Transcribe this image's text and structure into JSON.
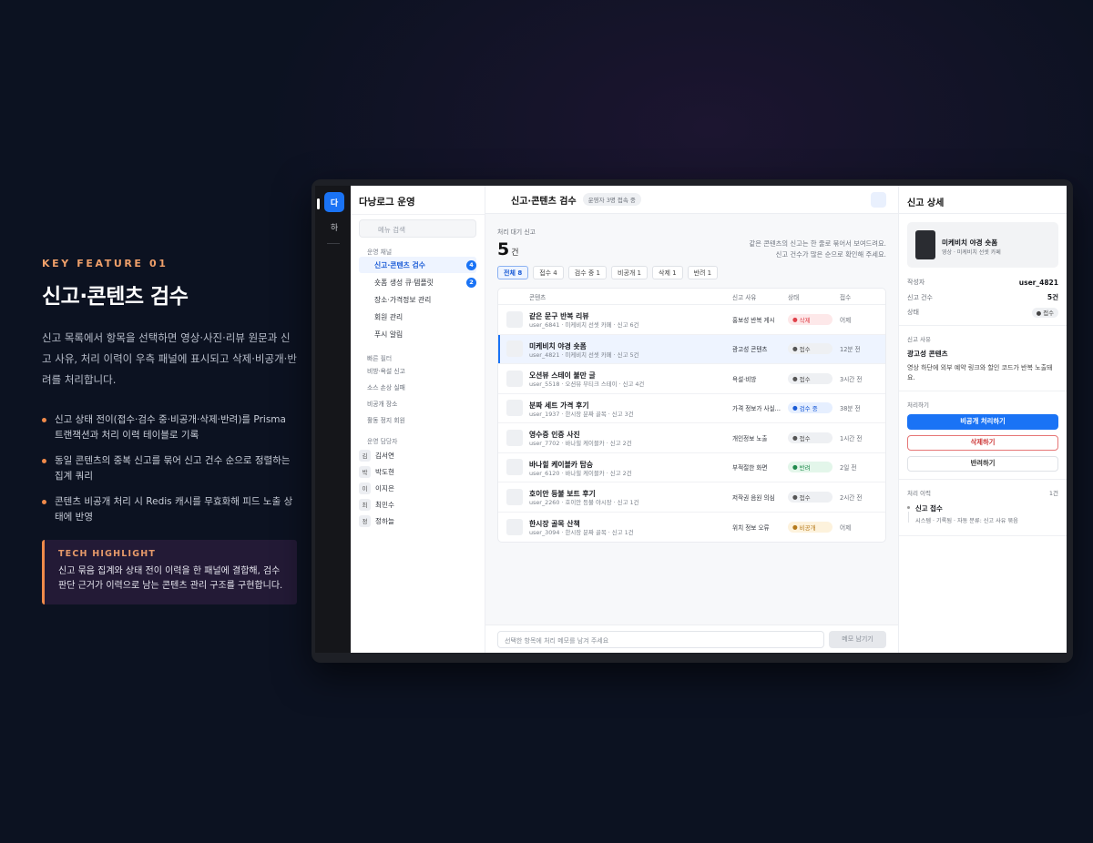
{
  "presentation": {
    "kicker": "KEY FEATURE 01",
    "title": "신고·콘텐츠 검수",
    "description": "신고 목록에서 항목을 선택하면 영상·사진·리뷰 원문과 신고 사유, 처리 이력이 우측 패널에 표시되고 삭제·비공개·반려를 처리합니다.",
    "bullets": [
      "신고 상태 전이(접수·검수 중·비공개·삭제·반려)를 Prisma 트랜잭션과 처리 이력 테이블로 기록",
      "동일 콘텐츠의 중복 신고를 묶어 신고 건수 순으로 정렬하는 집계 쿼리",
      "콘텐츠 비공개 처리 시 Redis 캐시를 무효화해 피드 노출 상태에 반영"
    ],
    "tech_title": "TECH HIGHLIGHT",
    "tech_desc": "신고 묶음 집계와 상태 전이 이력을 한 패널에 결합해, 검수 판단 근거가 이력으로 남는 콘텐츠 관리 구조를 구현합니다."
  },
  "rail": {
    "primary": "다",
    "secondary": "하"
  },
  "sidebar": {
    "brand": "다낭로그 운영",
    "search_placeholder": "메뉴 검색",
    "section_ops": "운영 채널",
    "items": [
      {
        "label": "신고·콘텐츠 검수",
        "badge": "4"
      },
      {
        "label": "숏폼 생성 큐·템플릿",
        "badge": "2"
      },
      {
        "label": "장소·가격정보 관리",
        "badge": ""
      },
      {
        "label": "회원 관리",
        "badge": ""
      },
      {
        "label": "푸시 알림",
        "badge": ""
      }
    ],
    "section_filter": "빠른 필터",
    "filters": [
      "비방·욕설 신고",
      "소스 손상 실패",
      "비공개 장소",
      "활동 정지 회원"
    ],
    "section_owner": "운영 담당자",
    "owners": [
      {
        "initial": "김",
        "name": "김서연"
      },
      {
        "initial": "박",
        "name": "박도현"
      },
      {
        "initial": "이",
        "name": "이지은"
      },
      {
        "initial": "최",
        "name": "최민수"
      },
      {
        "initial": "정",
        "name": "정하늘"
      }
    ]
  },
  "main": {
    "title": "신고·콘텐츠 검수",
    "chip": "운영자 3명 접속 중",
    "queue_label": "처리 대기 신고",
    "queue_count": "5",
    "queue_unit": "건",
    "note_line1": "같은 콘텐츠의 신고는 한 줄로 묶어서 보여드려요.",
    "note_line2": "신고 건수가 많은 순으로 확인해 주세요.",
    "tabs": [
      "전체 8",
      "접수 4",
      "검수 중 1",
      "비공개 1",
      "삭제 1",
      "반려 1"
    ],
    "columns": {
      "content": "콘텐츠",
      "reason": "신고 사유",
      "status": "상태",
      "time": "접수"
    },
    "rows": [
      {
        "title": "같은 문구 반복 리뷰",
        "sub": "user_6841 · 미케비치 선셋 카페 · 신고 6건",
        "reason": "홍보성 반복 게시",
        "status": "삭제",
        "status_color": "#e0414a",
        "status_bg": "#fde8e9",
        "time": "어제"
      },
      {
        "title": "미케비치 야경 숏폼",
        "sub": "user_4821 · 미케비치 선셋 카페 · 신고 5건",
        "reason": "광고성 콘텐츠",
        "status": "접수",
        "status_color": "#555555",
        "status_bg": "#eef0f3",
        "time": "12분 전"
      },
      {
        "title": "오션뷰 스테이 불만 글",
        "sub": "user_5518 · 오션뷰 부티크 스테이 · 신고 4건",
        "reason": "욕설·비방",
        "status": "접수",
        "status_color": "#555555",
        "status_bg": "#eef0f3",
        "time": "3시간 전"
      },
      {
        "title": "분짜 세트 가격 후기",
        "sub": "user_1937 · 한시장 분짜 골목 · 신고 3건",
        "reason": "가격 정보가 사실...",
        "status": "검수 중",
        "status_color": "#1a5bd6",
        "status_bg": "#e6efff",
        "time": "38분 전"
      },
      {
        "title": "영수증 인증 사진",
        "sub": "user_7702 · 바나힐 케이블카 · 신고 2건",
        "reason": "개인정보 노출",
        "status": "접수",
        "status_color": "#555555",
        "status_bg": "#eef0f3",
        "time": "1시간 전"
      },
      {
        "title": "바나힐 케이블카 탑승",
        "sub": "user_6120 · 바나힐 케이블카 · 신고 2건",
        "reason": "부적절한 화면",
        "status": "반려",
        "status_color": "#1f8a4c",
        "status_bg": "#e3f6ea",
        "time": "2일 전"
      },
      {
        "title": "호이안 등불 보트 후기",
        "sub": "user_2260 · 호이안 등불 야시장 · 신고 1건",
        "reason": "저작권 음원 의심",
        "status": "접수",
        "status_color": "#555555",
        "status_bg": "#eef0f3",
        "time": "2시간 전"
      },
      {
        "title": "한시장 골목 산책",
        "sub": "user_3094 · 한시장 분짜 골목 · 신고 1건",
        "reason": "위치 정보 오류",
        "status": "비공개",
        "status_color": "#b5791a",
        "status_bg": "#fdf2dc",
        "time": "어제"
      }
    ],
    "memo_placeholder": "선택한 항목에 처리 메모를 남겨 주세요",
    "memo_button": "메모 남기기"
  },
  "detail": {
    "title": "신고 상세",
    "card_title": "미케비치 야경 숏폼",
    "card_sub": "영상 · 미케비치 선셋 카페",
    "author_label": "작성자",
    "author": "user_4821",
    "count_label": "신고 건수",
    "count": "5건",
    "status_label": "상태",
    "status": "● 접수",
    "reason_label": "신고 사유",
    "reason_title": "광고성 콘텐츠",
    "reason_text": "영상 하단에 외부 예약 링크와 할인 코드가 반복 노출돼요.",
    "action_label": "처리하기",
    "btn_private": "비공개 처리하기",
    "btn_delete": "삭제하기",
    "btn_reject": "반려하기",
    "history_label": "처리 이력",
    "history_count": "1건",
    "history_title": "신고 접수",
    "history_sub": "시스템 · 기록됨 · 자동 분류: 신고 사유 묶음"
  }
}
